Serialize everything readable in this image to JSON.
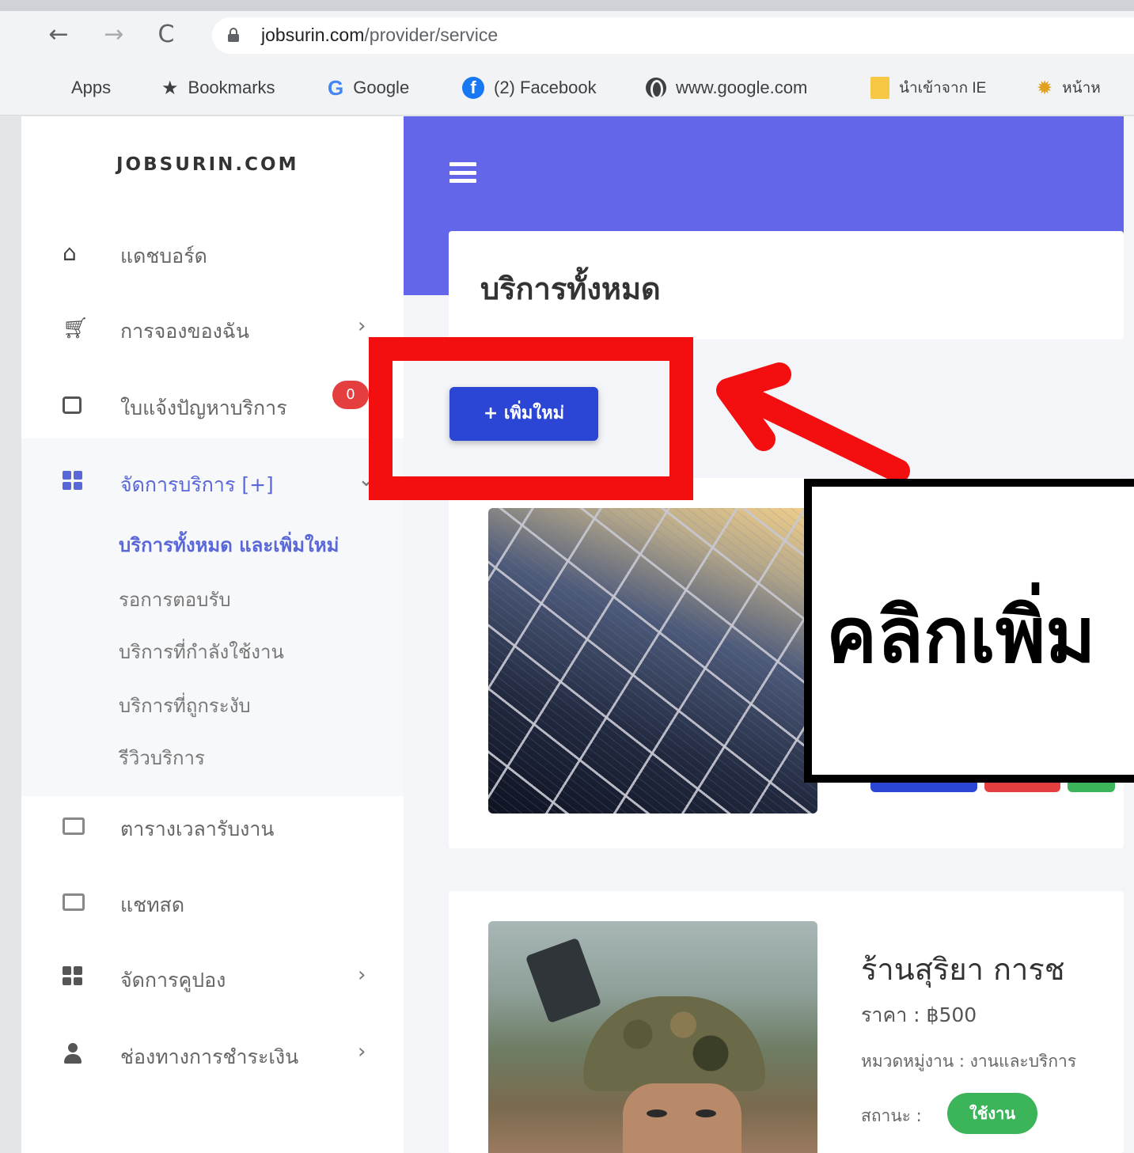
{
  "browser": {
    "url_domain": "jobsurin.com",
    "url_path": "/provider/service",
    "bookmarks": [
      {
        "label": "Apps",
        "icon": "apps-grid-icon"
      },
      {
        "label": "Bookmarks",
        "icon": "star-icon"
      },
      {
        "label": "Google",
        "icon": "google-icon"
      },
      {
        "label": "(2) Facebook",
        "icon": "facebook-icon"
      },
      {
        "label": "www.google.com",
        "icon": "globe-icon"
      },
      {
        "label": "นำเข้าจาก IE",
        "icon": "folder-icon"
      },
      {
        "label": "หน้าห",
        "icon": "bookmark-site-icon"
      }
    ]
  },
  "sidebar": {
    "brand": "JOBSURIN.COM",
    "items": [
      {
        "label": "แดชบอร์ด",
        "icon": "home-icon"
      },
      {
        "label": "การจองของฉัน",
        "icon": "cart-icon"
      },
      {
        "label": "ใบแจ้งปัญหาบริการ",
        "icon": "inbox-icon",
        "badge": "0"
      },
      {
        "label": "จัดการบริการ [+]",
        "icon": "grid-icon"
      },
      {
        "label": "ตารางเวลารับงาน",
        "icon": "calendar-icon"
      },
      {
        "label": "แชทสด",
        "icon": "chat-icon"
      },
      {
        "label": "จัดการคูปอง",
        "icon": "grid-icon"
      },
      {
        "label": "ช่องทางการชำระเงิน",
        "icon": "user-icon"
      }
    ],
    "submenu": [
      {
        "label": "บริการทั้งหมด และเพิ่มใหม่"
      },
      {
        "label": "รอการตอบรับ"
      },
      {
        "label": "บริการที่กำลังใช้งาน"
      },
      {
        "label": "บริการที่ถูกระงับ"
      },
      {
        "label": "รีวิวบริการ"
      }
    ]
  },
  "main": {
    "page_title": "บริการทั้งหมด",
    "add_button": "+ เพิ่มใหม่",
    "service2": {
      "title": "ร้านสุริยา การช",
      "price": "ราคา : ฿500",
      "category": "หมวดหมู่งาน : งานและบริการ",
      "status_label": "สถานะ :",
      "status_value": "ใช้งาน"
    }
  },
  "annotation": {
    "callout_text": "คลิกเพิ่ม",
    "highlight_color": "#f30f0f"
  },
  "colors": {
    "header": "#6366e8",
    "primary_button": "#2b45d4",
    "active_menu": "#5a67d8",
    "badge": "#e53e3e",
    "status_active": "#3cb55a"
  }
}
